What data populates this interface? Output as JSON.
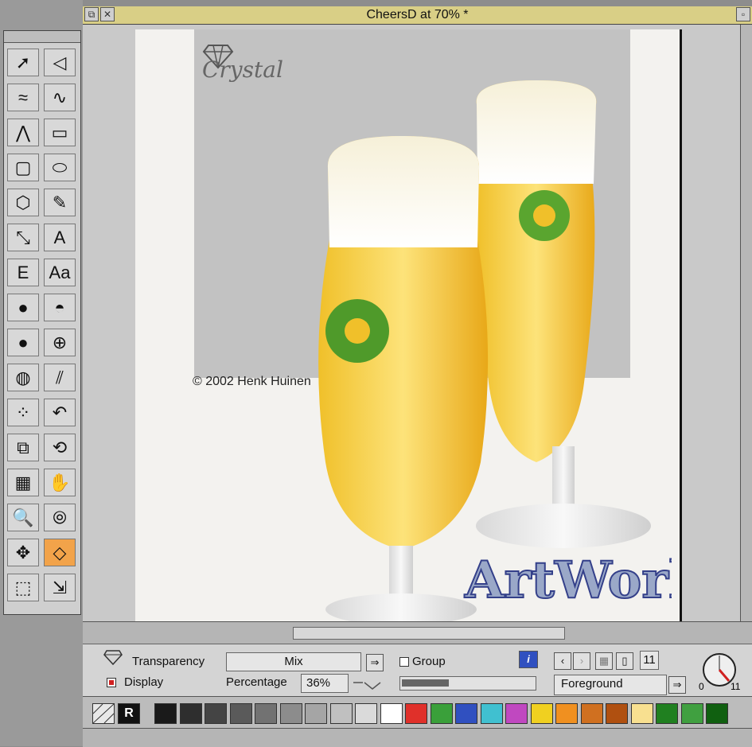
{
  "window": {
    "title": "CheersD at 70% *"
  },
  "artwork": {
    "brand_text": "Crystal",
    "copyright": "© 2002 Henk Huinen",
    "logo_text": "ArtWorks"
  },
  "toolbox": {
    "tools": [
      "select-icon",
      "edit-icon",
      "freehand-icon",
      "curve-icon",
      "polyline-icon",
      "rectangle-icon",
      "rounded-rect-icon",
      "ellipse-icon",
      "polygon-icon",
      "pencil-icon",
      "text-path-icon",
      "text-icon",
      "text-area-icon",
      "text-style-icon",
      "blend-icon",
      "radial-fill-icon",
      "sphere-icon",
      "mesh-icon",
      "hatch-icon",
      "shading-icon",
      "clip-group-icon",
      "undo-icon",
      "zoom-box-icon",
      "rotate-icon",
      "grid-icon",
      "hand-icon",
      "magnifier-icon",
      "circles-icon",
      "move-icon",
      "transparency-icon",
      "page-icon",
      "scale-icon"
    ],
    "labels": {
      "text": "A",
      "text_area": "E",
      "text_style": "Aa"
    }
  },
  "infobar": {
    "tool_name": "Transparency",
    "mode_value": "Mix",
    "group_label": "Group",
    "display_label": "Display",
    "percentage_label": "Percentage",
    "percentage_value": "36%",
    "percentage_fraction": 0.36,
    "line_width": "11",
    "fill_target": "Foreground",
    "dial_min": "0",
    "dial_max": "11"
  },
  "palette": {
    "none_label": "R",
    "colors": [
      "#1a1a1a",
      "#2e2e2e",
      "#444444",
      "#5a5a5a",
      "#727272",
      "#8c8c8c",
      "#a5a5a5",
      "#c0c0c0",
      "#dadada",
      "#ffffff",
      "#e0302a",
      "#3aa03a",
      "#3050c0",
      "#40c0d0",
      "#c048c0",
      "#f0d020",
      "#f09020",
      "#d07020",
      "#b05010",
      "#f8e090",
      "#208020",
      "#40a040",
      "#106010"
    ]
  }
}
